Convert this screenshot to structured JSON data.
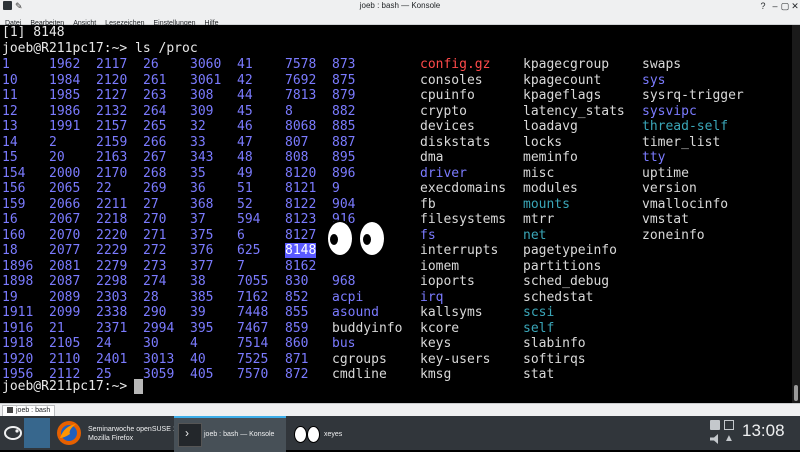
{
  "window": {
    "title": "joeb : bash — Konsole",
    "buttons": {
      "help": "?",
      "minimize": "–",
      "maximize": "▢",
      "close": "✕"
    }
  },
  "menu": [
    "Datei",
    "Bearbeiten",
    "Ansicht",
    "Lesezeichen",
    "Einstellungen",
    "Hilfe"
  ],
  "terminal": {
    "job_line": "[1] 8148",
    "prompt_line": "joeb@R211pc17:~> ls /proc",
    "final_prompt": "joeb@R211pc17:~> ",
    "highlight": "8148",
    "columns": [
      [
        "1",
        "10",
        "11",
        "12",
        "13",
        "14",
        "15",
        "154",
        "156",
        "159",
        "16",
        "160",
        "18",
        "1896",
        "1898",
        "19",
        "1911",
        "1916",
        "1918",
        "1920",
        "1956"
      ],
      [
        "1962",
        "1984",
        "1985",
        "1986",
        "1991",
        "2",
        "20",
        "2000",
        "2065",
        "2066",
        "2067",
        "2070",
        "2077",
        "2081",
        "2087",
        "2089",
        "2099",
        "21",
        "2105",
        "2110",
        "2112"
      ],
      [
        "2117",
        "2120",
        "2127",
        "2132",
        "2157",
        "2159",
        "2163",
        "2170",
        "22",
        "2211",
        "2218",
        "2220",
        "2229",
        "2279",
        "2298",
        "2303",
        "2338",
        "2371",
        "24",
        "2401",
        "25"
      ],
      [
        "26",
        "261",
        "263",
        "264",
        "265",
        "266",
        "267",
        "268",
        "269",
        "27",
        "270",
        "271",
        "272",
        "273",
        "274",
        "28",
        "290",
        "2994",
        "30",
        "3013",
        "3059"
      ],
      [
        "3060",
        "3061",
        "308",
        "309",
        "32",
        "33",
        "343",
        "35",
        "36",
        "368",
        "37",
        "375",
        "376",
        "377",
        "38",
        "385",
        "39",
        "395",
        "4",
        "40",
        "405"
      ],
      [
        "41",
        "42",
        "44",
        "45",
        "46",
        "47",
        "48",
        "49",
        "51",
        "52",
        "594",
        "6",
        "625",
        "7",
        "7055",
        "7162",
        "7448",
        "7467",
        "7514",
        "7525",
        "7570"
      ],
      [
        "7578",
        "7692",
        "7813",
        "8",
        "8068",
        "807",
        "808",
        "8120",
        "8121",
        "8122",
        "8123",
        "8127",
        "8148",
        "8162",
        "830",
        "852",
        "855",
        "859",
        "860",
        "871",
        "872"
      ],
      [
        "873",
        "875",
        "879",
        "882",
        "885",
        "887",
        "895",
        "896",
        "9",
        "904",
        "916",
        "",
        "95",
        "",
        "968",
        "acpi",
        "asound",
        "buddyinfo",
        "bus",
        "cgroups",
        "cmdline"
      ],
      [
        "config.gz",
        "consoles",
        "cpuinfo",
        "crypto",
        "devices",
        "diskstats",
        "dma",
        "driver",
        "execdomains",
        "fb",
        "filesystems",
        "fs",
        "interrupts",
        "iomem",
        "ioports",
        "irq",
        "kallsyms",
        "kcore",
        "keys",
        "key-users",
        "kmsg"
      ],
      [
        "kpagecgroup",
        "kpagecount",
        "kpageflags",
        "latency_stats",
        "loadavg",
        "locks",
        "meminfo",
        "misc",
        "modules",
        "mounts",
        "mtrr",
        "net",
        "pagetypeinfo",
        "partitions",
        "sched_debug",
        "schedstat",
        "scsi",
        "self",
        "slabinfo",
        "softirqs",
        "stat"
      ],
      [
        "swaps",
        "sys",
        "sysrq-trigger",
        "sysvipc",
        "thread-self",
        "timer_list",
        "tty",
        "uptime",
        "version",
        "vmallocinfo",
        "vmstat",
        "zoneinfo"
      ]
    ]
  },
  "tab": {
    "label": "joeb : bash"
  },
  "taskbar": {
    "firefox": {
      "line1": "Seminarwoche openSUSE 15.0 -",
      "line2": "Mozilla Firefox"
    },
    "konsole": {
      "label": "joeb : bash — Konsole"
    },
    "xeyes": {
      "label": "xeyes"
    }
  },
  "clock": {
    "time": "13:08"
  },
  "colors": {
    "numbers": "#7b7bff",
    "plain": "#d9d9d9",
    "archive": "#ff4a4a",
    "symlink": "#3aa6b8",
    "directory": "#7b7bff",
    "panel": "#31363b"
  }
}
